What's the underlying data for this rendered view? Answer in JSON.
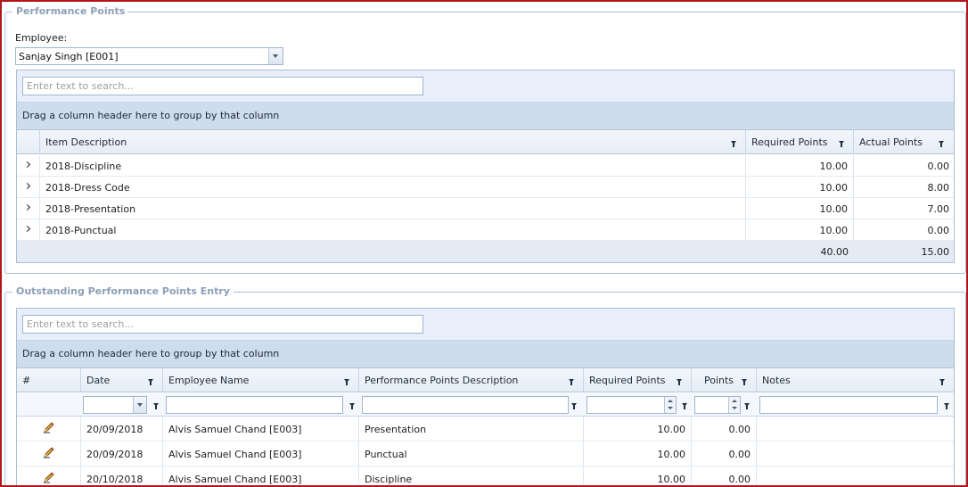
{
  "performance_points": {
    "legend": "Performance Points",
    "employee_label": "Employee:",
    "employee_value": "Sanjay Singh [E001]",
    "search_placeholder": "Enter text to search...",
    "group_hint": "Drag a column header here to group by that column",
    "columns": [
      "Item Description",
      "Required Points",
      "Actual Points"
    ],
    "rows": [
      {
        "item": "2018-Discipline",
        "required": "10.00",
        "actual": "0.00"
      },
      {
        "item": "2018-Dress Code",
        "required": "10.00",
        "actual": "8.00"
      },
      {
        "item": "2018-Presentation",
        "required": "10.00",
        "actual": "7.00"
      },
      {
        "item": "2018-Punctual",
        "required": "10.00",
        "actual": "0.00"
      }
    ],
    "totals": {
      "required": "40.00",
      "actual": "15.00"
    }
  },
  "outstanding": {
    "legend": "Outstanding Performance Points Entry",
    "search_placeholder": "Enter text to search...",
    "group_hint": "Drag a column header here to group by that column",
    "columns": [
      "#",
      "Date",
      "Employee Name",
      "Performance Points Description",
      "Required Points",
      "Points",
      "Notes"
    ],
    "rows": [
      {
        "date": "20/09/2018",
        "employee": "Alvis Samuel Chand [E003]",
        "description": "Presentation",
        "required": "10.00",
        "points": "0.00",
        "notes": ""
      },
      {
        "date": "20/09/2018",
        "employee": "Alvis Samuel Chand [E003]",
        "description": "Punctual",
        "required": "10.00",
        "points": "0.00",
        "notes": ""
      },
      {
        "date": "20/10/2018",
        "employee": "Alvis Samuel Chand [E003]",
        "description": "Discipline",
        "required": "10.00",
        "points": "0.00",
        "notes": ""
      }
    ]
  },
  "icons": {
    "row_action": "edit-pencil-icon",
    "filter": "funnel-icon",
    "expand": "chevron-right-icon"
  },
  "colors": {
    "frame_border": "#b0161c",
    "legend_text": "#8c9fb5",
    "group_bar": "#cedcec",
    "search_bar": "#e8effa"
  }
}
